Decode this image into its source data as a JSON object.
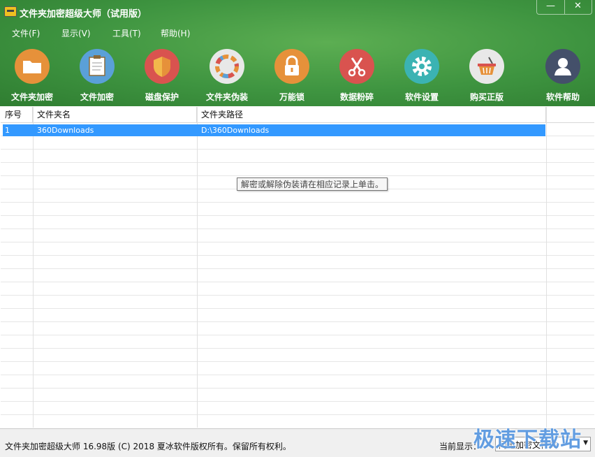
{
  "window": {
    "title": "文件夹加密超级大师（试用版）",
    "minimize_label": "—",
    "close_label": "✕"
  },
  "menu": [
    {
      "label": "文件(F)"
    },
    {
      "label": "显示(V)"
    },
    {
      "label": "工具(T)"
    },
    {
      "label": "帮助(H)"
    }
  ],
  "toolbar": [
    {
      "label": "文件夹加密",
      "icon": "folder-icon",
      "color": "#e6913a"
    },
    {
      "label": "文件加密",
      "icon": "document-icon",
      "color": "#5aa0d8"
    },
    {
      "label": "磁盘保护",
      "icon": "shield-icon",
      "color": "#d9534f"
    },
    {
      "label": "文件夹伪装",
      "icon": "palette-icon",
      "color": "#e8e8e8"
    },
    {
      "label": "万能锁",
      "icon": "padlock-icon",
      "color": "#e6913a"
    },
    {
      "label": "数据粉碎",
      "icon": "scissors-icon",
      "color": "#d9534f"
    },
    {
      "label": "软件设置",
      "icon": "gear-icon",
      "color": "#3bb3b3"
    },
    {
      "label": "购买正版",
      "icon": "basket-icon",
      "color": "#e8e8e8"
    },
    {
      "label": "软件帮助",
      "icon": "user-help-icon",
      "color": "#44506a"
    }
  ],
  "table": {
    "columns": [
      "序号",
      "文件夹名",
      "文件夹路径"
    ],
    "rows": [
      {
        "index": "1",
        "name": "360Downloads",
        "path": "D:\\360Downloads"
      }
    ]
  },
  "tooltip": "解密或解除伪装请在相应记录上单击。",
  "status": {
    "copyright": "文件夹加密超级大师 16.98版 (C) 2018   夏冰软件版权所有。保留所有权利。",
    "current_label": "当前显示：",
    "current_value": "闪电加密文件夹"
  },
  "watermark": "极速下载站"
}
